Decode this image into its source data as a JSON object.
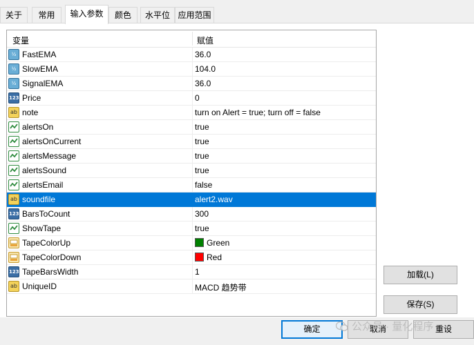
{
  "tabs": [
    "关于",
    "常用",
    "输入参数",
    "颜色",
    "水平位",
    "应用范围"
  ],
  "active_tab": "输入参数",
  "grid": {
    "header_variable": "变量",
    "header_value": "赋值",
    "rows": [
      {
        "type": "double",
        "icon_text": "½",
        "name": "FastEMA",
        "value": "36.0"
      },
      {
        "type": "double",
        "icon_text": "½",
        "name": "SlowEMA",
        "value": "104.0"
      },
      {
        "type": "double",
        "icon_text": "½",
        "name": "SignalEMA",
        "value": "36.0"
      },
      {
        "type": "int",
        "icon_text": "123",
        "name": "Price",
        "value": "0"
      },
      {
        "type": "string",
        "icon_text": "ab",
        "name": "note",
        "value": "turn on Alert = true; turn off = false"
      },
      {
        "type": "bool",
        "icon_text": "",
        "name": "alertsOn",
        "value": "true"
      },
      {
        "type": "bool",
        "icon_text": "",
        "name": "alertsOnCurrent",
        "value": "true"
      },
      {
        "type": "bool",
        "icon_text": "",
        "name": "alertsMessage",
        "value": "true"
      },
      {
        "type": "bool",
        "icon_text": "",
        "name": "alertsSound",
        "value": "true"
      },
      {
        "type": "bool",
        "icon_text": "",
        "name": "alertsEmail",
        "value": "false"
      },
      {
        "type": "string",
        "icon_text": "ab",
        "name": "soundfile",
        "value": "alert2.wav",
        "selected": true
      },
      {
        "type": "int",
        "icon_text": "123",
        "name": "BarsToCount",
        "value": "300"
      },
      {
        "type": "bool",
        "icon_text": "",
        "name": "ShowTape",
        "value": "true"
      },
      {
        "type": "color",
        "icon_text": "",
        "name": "TapeColorUp",
        "value": "Green",
        "swatch": "#008000"
      },
      {
        "type": "color",
        "icon_text": "",
        "name": "TapeColorDown",
        "value": "Red",
        "swatch": "#ff0000"
      },
      {
        "type": "int",
        "icon_text": "123",
        "name": "TapeBarsWidth",
        "value": "1"
      },
      {
        "type": "string",
        "icon_text": "ab",
        "name": "UniqueID",
        "value": "MACD 趋势带"
      }
    ]
  },
  "buttons": {
    "load": "加载(L)",
    "save": "保存(S)",
    "ok": "确定",
    "cancel": "取消",
    "reset": "重设"
  },
  "watermark": "公众号 · 量化程序",
  "colors": {
    "selection": "#0078d7",
    "green": "#008000",
    "red": "#ff0000"
  }
}
